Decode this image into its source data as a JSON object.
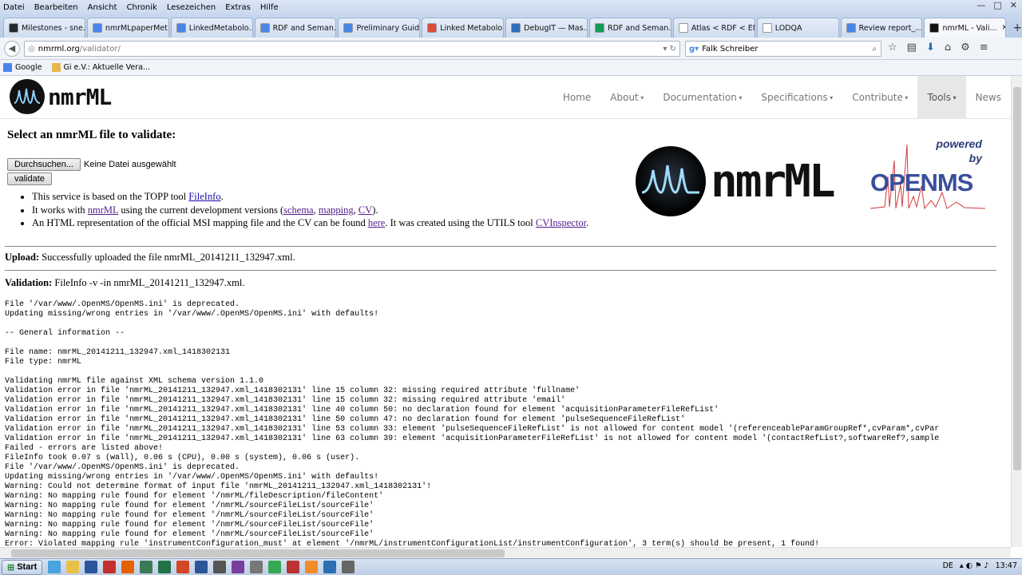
{
  "menubar": {
    "items": [
      "Datei",
      "Bearbeiten",
      "Ansicht",
      "Chronik",
      "Lesezeichen",
      "Extras",
      "Hilfe"
    ]
  },
  "tabs": [
    {
      "label": "Milestones - sne...",
      "color": "#24292e"
    },
    {
      "label": "nmrMLpaperMet...",
      "color": "#4a86e8"
    },
    {
      "label": "LinkedMetabolo...",
      "color": "#4a86e8"
    },
    {
      "label": "RDF and Seman...",
      "color": "#4a86e8"
    },
    {
      "label": "Preliminary Guid...",
      "color": "#4a86e8"
    },
    {
      "label": "Linked Metabolo...",
      "color": "#dd4b39"
    },
    {
      "label": "DebugIT — Mas...",
      "color": "#2a6ebb"
    },
    {
      "label": "RDF and Seman...",
      "color": "#0f9d58"
    },
    {
      "label": "Atlas < RDF < EMBL...",
      "color": "#ffffff"
    },
    {
      "label": "LODQA",
      "color": "#ffffff"
    },
    {
      "label": "Review report_...",
      "color": "#4a86e8"
    },
    {
      "label": "nmrML - Vali...",
      "color": "#111111",
      "active": true
    }
  ],
  "url": {
    "host": "nmrml.org",
    "path": "/validator/"
  },
  "search": {
    "value": "Falk Schreiber"
  },
  "bookmarks": [
    {
      "label": "Google",
      "color": "#4a86e8"
    },
    {
      "label": "Gi e.V.: Aktuelle Vera...",
      "color": "#e6b94d"
    }
  ],
  "site": {
    "logo_text": "nmrML",
    "nav": [
      "Home",
      "About",
      "Documentation",
      "Specifications",
      "Contribute",
      "Tools",
      "News"
    ],
    "nav_dropdown_suffix": " ▾"
  },
  "form": {
    "heading": "Select an nmrML file to validate:",
    "browse_label": "Durchsuchen...",
    "no_file": "Keine Datei ausgewählt",
    "submit_label": "validate"
  },
  "notes": {
    "n1_pre": "This service is based on the TOPP tool ",
    "n1_link": "FileInfo",
    "n1_post": ".",
    "n2_pre": "It works with ",
    "n2_link1": "nmrML",
    "n2_mid": " using the current development versions (",
    "n2_link2": "schema",
    "n2_sep1": ", ",
    "n2_link3": "mapping",
    "n2_sep2": ", ",
    "n2_link4": "CV",
    "n2_post": ").",
    "n3_pre": "An HTML representation of the official MSI mapping file and the CV can be found ",
    "n3_link1": "here",
    "n3_mid": ". It was created using the UTILS tool ",
    "n3_link2": "CVInspector",
    "n3_post": "."
  },
  "branding": {
    "big_logo_text": "nmrML",
    "powered": "powered",
    "by": "by",
    "openms": "OPENMS"
  },
  "upload": {
    "label": "Upload:",
    "text": " Successfully uploaded the file nmrML_20141211_132947.xml."
  },
  "validation": {
    "label": "Validation:",
    "text": " FileInfo -v -in nmrML_20141211_132947.xml."
  },
  "log": [
    "File '/var/www/.OpenMS/OpenMS.ini' is deprecated.",
    "Updating missing/wrong entries in '/var/www/.OpenMS/OpenMS.ini' with defaults!",
    "",
    "-- General information --",
    "",
    "File name: nmrML_20141211_132947.xml_1418302131",
    "File type: nmrML",
    "",
    "Validating nmrML file against XML schema version 1.1.0",
    "Validation error in file 'nmrML_20141211_132947.xml_1418302131' line 15 column 32: missing required attribute 'fullname'",
    "Validation error in file 'nmrML_20141211_132947.xml_1418302131' line 15 column 32: missing required attribute 'email'",
    "Validation error in file 'nmrML_20141211_132947.xml_1418302131' line 40 column 50: no declaration found for element 'acquisitionParameterFileRefList'",
    "Validation error in file 'nmrML_20141211_132947.xml_1418302131' line 50 column 47: no declaration found for element 'pulseSequenceFileRefList'",
    "Validation error in file 'nmrML_20141211_132947.xml_1418302131' line 53 column 33: element 'pulseSequenceFileRefList' is not allowed for content model '(referenceableParamGroupRef*,cvParam*,cvPar",
    "Validation error in file 'nmrML_20141211_132947.xml_1418302131' line 63 column 39: element 'acquisitionParameterFileRefList' is not allowed for content model '(contactRefList?,softwareRef?,sample",
    "Failed - errors are listed above!",
    "FileInfo took 0.07 s (wall), 0.06 s (CPU), 0.00 s (system), 0.06 s (user).",
    "File '/var/www/.OpenMS/OpenMS.ini' is deprecated.",
    "Updating missing/wrong entries in '/var/www/.OpenMS/OpenMS.ini' with defaults!",
    "Warning: Could not determine format of input file 'nmrML_20141211_132947.xml_1418302131'!",
    "Warning: No mapping rule found for element '/nmrML/fileDescription/fileContent'",
    "Warning: No mapping rule found for element '/nmrML/sourceFileList/sourceFile'",
    "Warning: No mapping rule found for element '/nmrML/sourceFileList/sourceFile'",
    "Warning: No mapping rule found for element '/nmrML/sourceFileList/sourceFile'",
    "Warning: No mapping rule found for element '/nmrML/sourceFileList/sourceFile'",
    "Error: Violated mapping rule 'instrumentConfiguration_must' at element '/nmrML/instrumentConfigurationList/instrumentConfiguration', 3 term(s) should be present, 1 found!"
  ],
  "taskbar": {
    "start_label": "Start",
    "apps": [
      "#4aa3df",
      "#e8c14a",
      "#2b579a",
      "#c4302b",
      "#e66000",
      "#3b7a57",
      "#217346",
      "#d24726",
      "#2b579a",
      "#555",
      "#7a3f9d",
      "#777",
      "#34a853",
      "#b33",
      "#f28c28",
      "#2e6fb3",
      "#666"
    ],
    "lang": "DE",
    "time": "13:47"
  }
}
